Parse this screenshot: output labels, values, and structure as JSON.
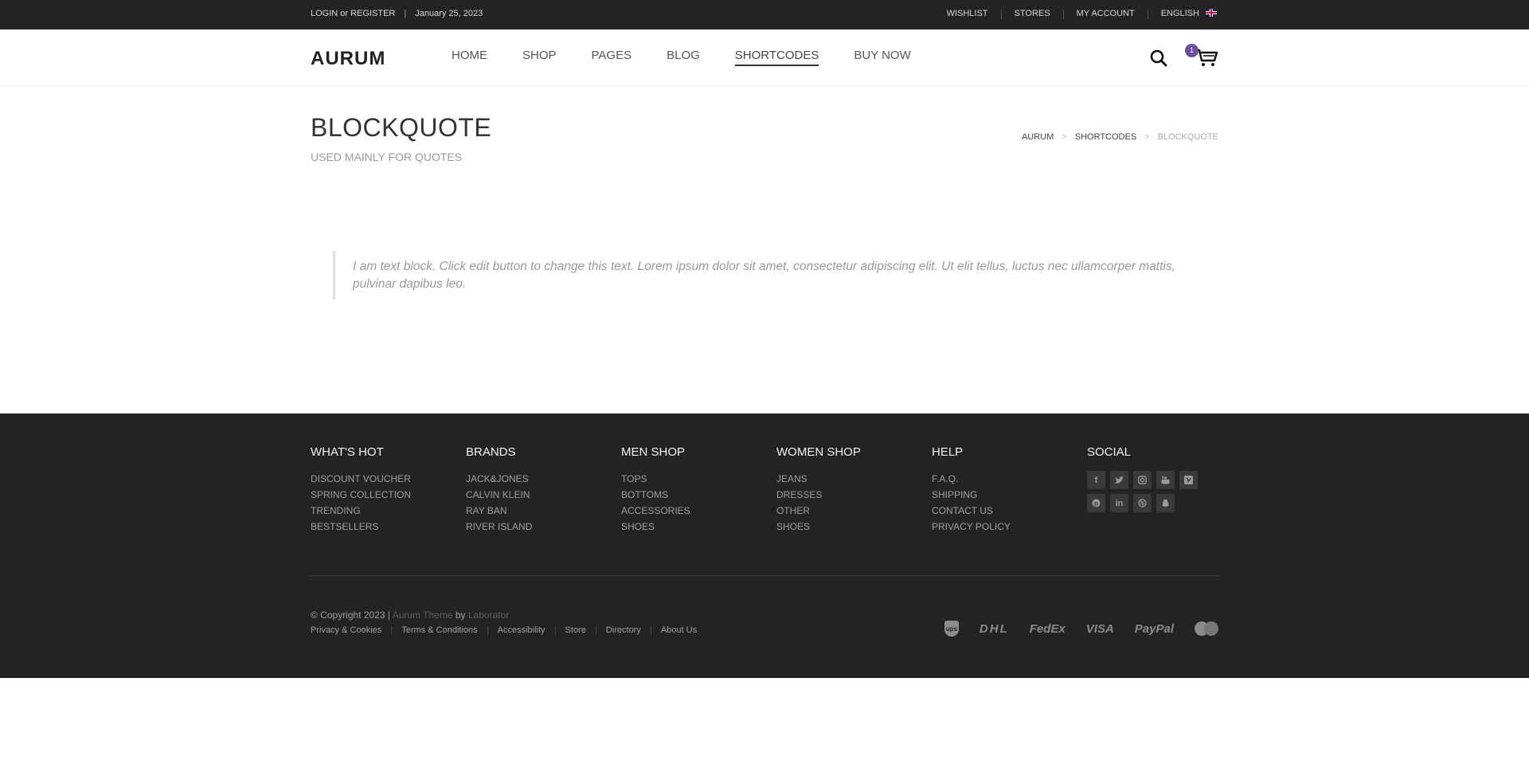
{
  "topbar": {
    "login_register": "LOGIN or REGISTER",
    "separator": "|",
    "date": "January 25, 2023",
    "links": [
      "WISHLIST",
      "STORES",
      "MY ACCOUNT",
      "ENGLISH"
    ]
  },
  "header": {
    "logo": "AURUM",
    "nav": [
      "HOME",
      "SHOP",
      "PAGES",
      "BLOG",
      "SHORTCODES",
      "BUY NOW"
    ],
    "active_nav": "SHORTCODES",
    "cart_count": "1"
  },
  "page": {
    "title": "BLOCKQUOTE",
    "subtitle": "USED MAINLY FOR QUOTES",
    "breadcrumb": [
      "AURUM",
      "SHORTCODES",
      "BLOCKQUOTE"
    ],
    "breadcrumb_separator": ">"
  },
  "quote": {
    "text": "I am text block. Click edit button to change this text. Lorem ipsum dolor sit amet, consectetur adipiscing elit. Ut elit tellus, luctus nec ullamcorper mattis, pulvinar dapibus leo."
  },
  "footer": {
    "columns": [
      {
        "title": "WHAT'S HOT",
        "items": [
          "DISCOUNT VOUCHER",
          "SPRING COLLECTION",
          "TRENDING",
          "BESTSELLERS"
        ]
      },
      {
        "title": "BRANDS",
        "items": [
          "JACK&JONES",
          "CALVIN KLEIN",
          "RAY BAN",
          "RIVER ISLAND"
        ]
      },
      {
        "title": "MEN SHOP",
        "items": [
          "TOPS",
          "BOTTOMS",
          "ACCESSORIES",
          "SHOES"
        ]
      },
      {
        "title": "WOMEN SHOP",
        "items": [
          "JEANS",
          "DRESSES",
          "OTHER",
          "SHOES"
        ]
      },
      {
        "title": "HELP",
        "items": [
          "F.A.Q.",
          "SHIPPING",
          "CONTACT US",
          "PRIVACY POLICY"
        ]
      }
    ],
    "social_title": "SOCIAL",
    "social_icons": [
      "facebook-icon",
      "twitter-icon",
      "instagram-icon",
      "youtube-icon",
      "vimeo-icon",
      "pinterest-icon",
      "linkedin-icon",
      "dribbble-icon",
      "snapchat-icon"
    ],
    "copyright_prefix": "© Copyright 2023 |",
    "theme_name": "Aurum Theme",
    "by": "by",
    "author": "Laborator",
    "links": [
      "Privacy & Cookies",
      "Terms & Conditions",
      "Accessibility",
      "Store",
      "Directory",
      "About Us"
    ],
    "payments": [
      "ups",
      "DHL",
      "FedEx",
      "VISA",
      "PayPal",
      "mastercard"
    ]
  },
  "colors": {
    "dark_bg": "#232323",
    "badge": "#6e4e9e",
    "muted_text": "#9f9f9f"
  }
}
